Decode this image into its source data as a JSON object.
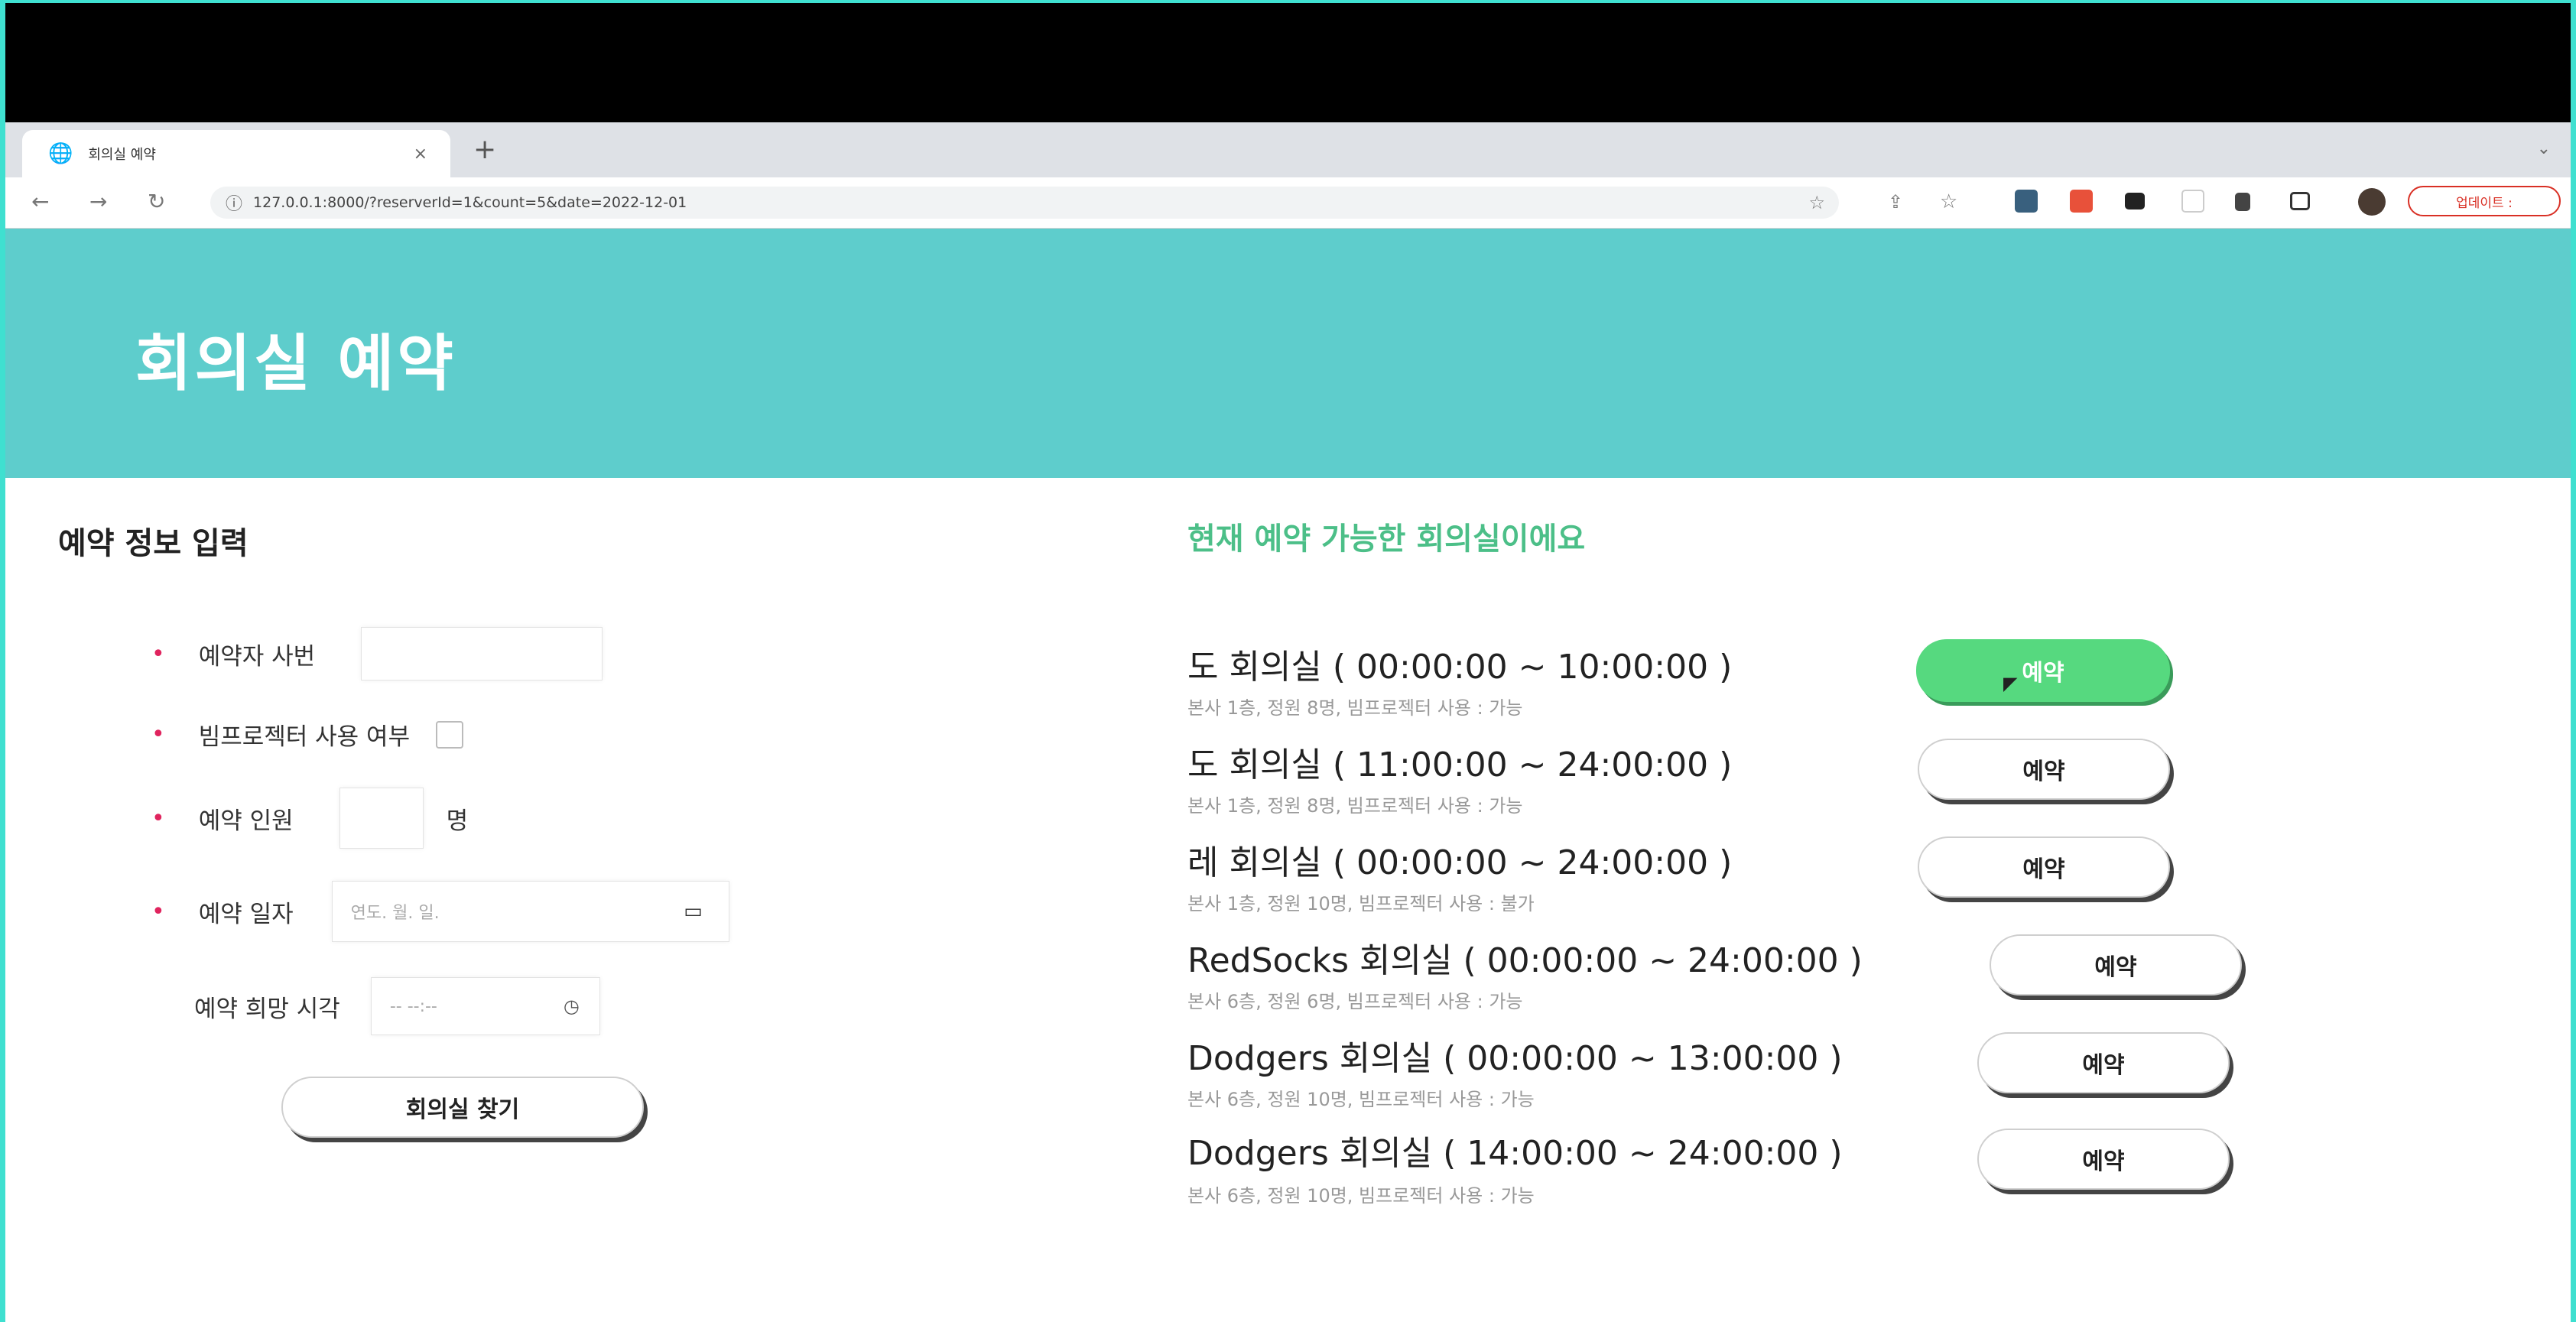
{
  "browser": {
    "tab_title": "회의실 예약",
    "url": "127.0.0.1:8000/?reserverId=1&count=5&date=2022-12-01",
    "update_label": "업데이트 :"
  },
  "header": {
    "title": "회의실 예약"
  },
  "form": {
    "section_title": "예약 정보 입력",
    "fields": [
      {
        "label": "예약자 사번",
        "required": true
      },
      {
        "label": "빔프로젝터 사용 여부",
        "required": true
      },
      {
        "label": "예약 인원",
        "required": true,
        "suffix": "명"
      },
      {
        "label": "예약 일자",
        "required": true,
        "placeholder": "연도. 월. 일."
      },
      {
        "label": "예약 희망 시각",
        "required": false,
        "placeholder": "-- --:--"
      }
    ],
    "search_button": "회의실 찾기"
  },
  "rooms": {
    "title": "현재 예약 가능한 회의실이에요",
    "items": [
      {
        "name": "도 회의실 ( 00:00:00 ~ 10:00:00 )",
        "desc": "본사 1층, 정원 8명, 빔프로젝터 사용 : 가능",
        "button": "예약",
        "active": true
      },
      {
        "name": "도 회의실 ( 11:00:00 ~ 24:00:00 )",
        "desc": "본사 1층, 정원 8명, 빔프로젝터 사용 : 가능",
        "button": "예약"
      },
      {
        "name": "레 회의실 ( 00:00:00 ~ 24:00:00 )",
        "desc": "본사 1층, 정원 10명, 빔프로젝터 사용 : 불가",
        "button": "예약"
      },
      {
        "name": "RedSocks 회의실 ( 00:00:00 ~ 24:00:00 )",
        "desc": "본사 6층, 정원 6명, 빔프로젝터 사용 : 가능",
        "button": "예약"
      },
      {
        "name": "Dodgers 회의실 ( 00:00:00 ~ 13:00:00 )",
        "desc": "본사 6층, 정원 10명, 빔프로젝터 사용 : 가능",
        "button": "예약"
      },
      {
        "name": "Dodgers 회의실 ( 14:00:00 ~ 24:00:00 )",
        "desc": "본사 6층, 정원 10명, 빔프로젝터 사용 : 가능",
        "button": "예약"
      }
    ]
  },
  "colors": {
    "frame": "#3fe0d0",
    "header": "#5ecdcc",
    "active_button": "#56d97f",
    "accent_text": "#4cbf88",
    "required": "#e0245e"
  }
}
